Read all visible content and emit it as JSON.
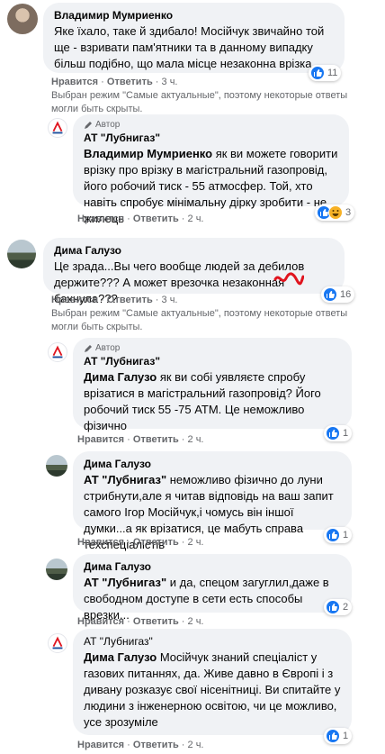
{
  "colors": {
    "bubble": "#f0f2f5",
    "meta": "#65676b",
    "like": "#1877f2",
    "haha": "#f7b125",
    "scribble": "#e0141e"
  },
  "labels": {
    "like": "Нравится",
    "reply": "Ответить",
    "sep": "·",
    "author": "Автор"
  },
  "comments": [
    {
      "name": "Владимир Мумриенко",
      "text": "Яке їхало, таке й здибало! Мосійчук звичайно той ще - взривати пам'ятники та в данному випадку більш подібно, що мала місце незаконна врізка.",
      "time": "3 ч.",
      "reactions": [
        "like-icon"
      ],
      "reaction_count": "11",
      "notice": "Выбран режим \"Самые актуальные\", поэтому некоторые ответы могли быть скрыты."
    },
    {
      "name": "АТ \"Лубнигаз\"",
      "mention": "Владимир Мумриенко",
      "text": " як ви можете говорити врізку про врізку в магістральний газопровід, його робочий тиск - 55 атмосфер. Той, хто навіть спробує мінімальну дірку зробити - не жилець",
      "time": "2 ч.",
      "reactions": [
        "like-icon",
        "haha-icon"
      ],
      "reaction_count": "3"
    },
    {
      "name": "Дима Галузо",
      "text": "Це зрада...Вы чего вообще людей за дебилов держите??? А может врезочка незаконная бахнула???",
      "time": "3 ч.",
      "reactions": [
        "like-icon"
      ],
      "reaction_count": "16",
      "notice": "Выбран режим \"Самые актуальные\", поэтому некоторые ответы могли быть скрыты."
    },
    {
      "name": "АТ \"Лубнигаз\"",
      "mention": "Дима Галузо",
      "text": " як ви собі уявляєте спробу врізатися в магістральний газопровід? Його робочий тиск 55 -75 АТМ. Це неможливо фізично",
      "time": "2 ч.",
      "reactions": [
        "like-icon"
      ],
      "reaction_count": "1"
    },
    {
      "name": "Дима Галузо",
      "mention": "АТ \"Лубнигаз\"",
      "text": " неможливо фізично до луни стрибнути,але я читав відповідь на ваш запит самого Ігор Мосійчук,і чомусь він іншої думки...а як врізатися, це мабуть справа техспеціалістів",
      "time": "2 ч.",
      "reactions": [
        "like-icon"
      ],
      "reaction_count": "1"
    },
    {
      "name": "Дима Галузо",
      "mention": "АТ \"Лубнигаз\"",
      "text": " и да, спецом загуглил,даже в свободном доступе в сети есть способы врезки...",
      "time": "2 ч.",
      "reactions": [
        "like-icon"
      ],
      "reaction_count": "2"
    },
    {
      "name": "АТ \"Лубнигаз\"",
      "mention": "Дима Галузо",
      "text": " Мосійчук знаний спеціаліст у газових питаннях, да. Живе давно в Європі і з дивану розказує свої нісенітниці. Ви спитайте у людини з інженерною освітою, чи це можливо, усе зрозуміле",
      "time": "2 ч.",
      "reactions": [
        "like-icon"
      ],
      "reaction_count": "1"
    }
  ]
}
